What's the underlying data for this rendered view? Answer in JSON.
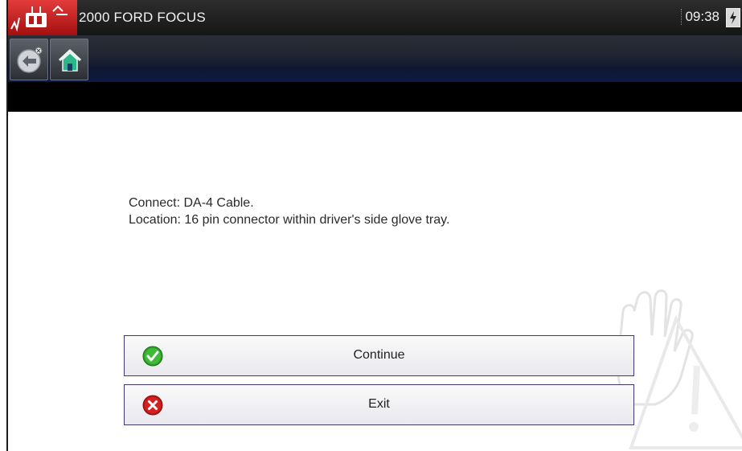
{
  "titlebar": {
    "vehicle": "2000 FORD FOCUS",
    "time": "09:38",
    "app_icon": "vehicle-comm-icon",
    "battery_icon": "battery-charging-icon"
  },
  "toolbar": {
    "back_icon": "back-arrow-icon",
    "home_icon": "home-icon"
  },
  "message": {
    "line1": "Connect: DA-4 Cable.",
    "line2": "Location: 16 pin connector within driver's side glove tray."
  },
  "buttons": {
    "continue": {
      "label": "Continue",
      "icon": "check-circle-icon",
      "color": "#2e9e2a"
    },
    "exit": {
      "label": "Exit",
      "icon": "x-circle-icon",
      "color": "#d42222"
    }
  },
  "colors": {
    "titlebar": "#1f1f1f",
    "app_badge": "#c62020",
    "toolbar_accent": "#0b1a44",
    "button_border": "#3c3a6e"
  }
}
